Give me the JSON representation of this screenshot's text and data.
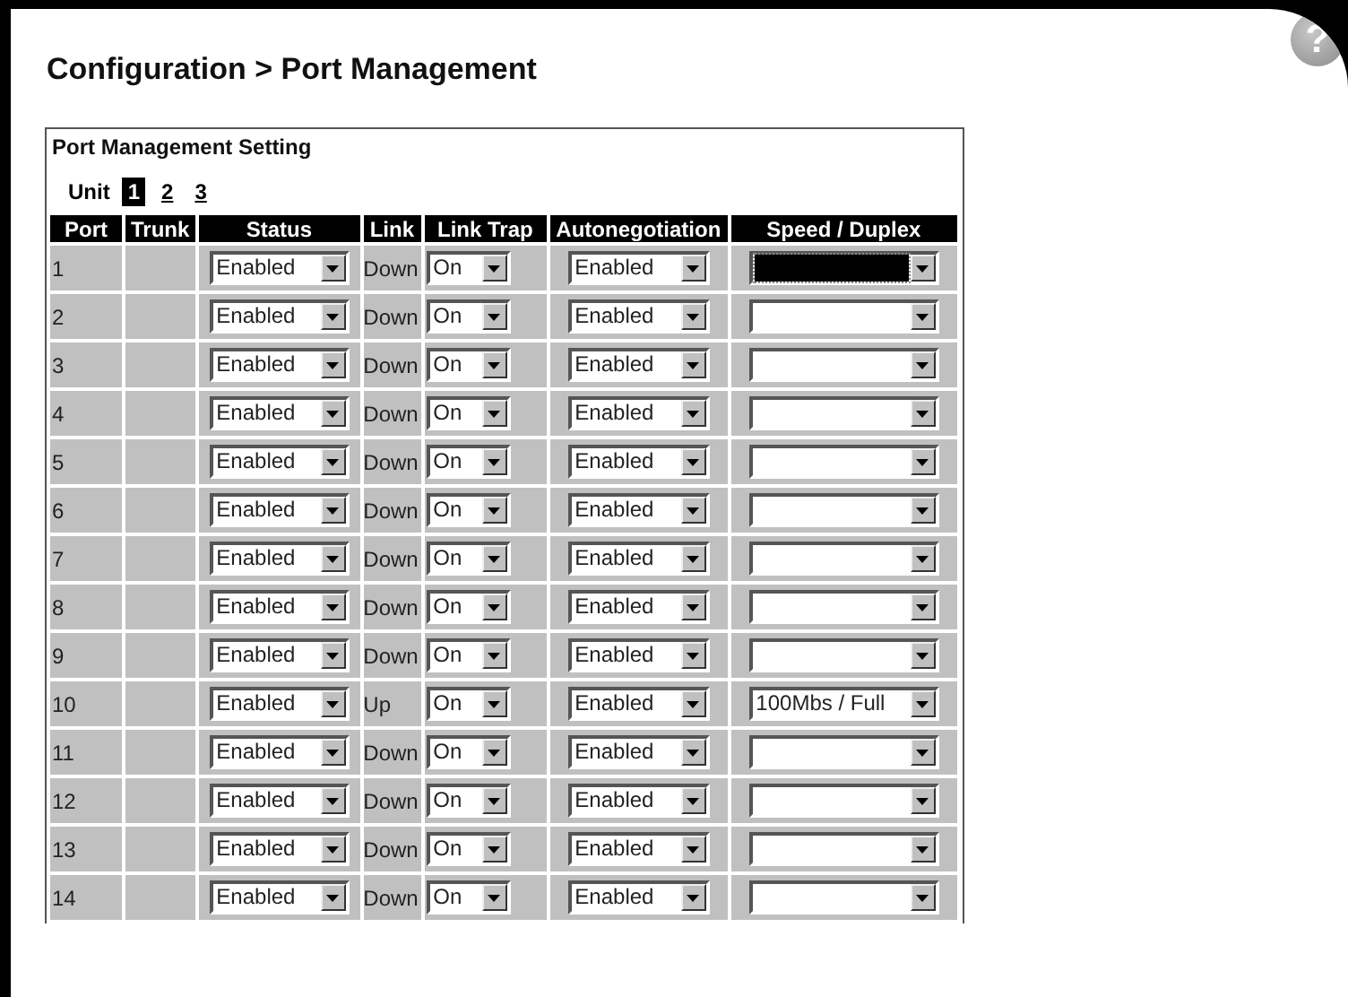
{
  "page_title": "Configuration > Port Management",
  "help": {
    "glyph": "?"
  },
  "section_title": "Port Management Setting",
  "unit_label": "Unit",
  "units": [
    {
      "label": "1",
      "selected": true
    },
    {
      "label": "2",
      "selected": false
    },
    {
      "label": "3",
      "selected": false
    }
  ],
  "columns": [
    "Port",
    "Trunk",
    "Status",
    "Link",
    "Link Trap",
    "Autonegotiation",
    "Speed / Duplex"
  ],
  "rows": [
    {
      "port": "1",
      "status": "Enabled",
      "link": "Down",
      "link_trap": "On",
      "autonegotiation": "Enabled",
      "speed_duplex": "",
      "focused": true
    },
    {
      "port": "2",
      "status": "Enabled",
      "link": "Down",
      "link_trap": "On",
      "autonegotiation": "Enabled",
      "speed_duplex": "",
      "focused": false
    },
    {
      "port": "3",
      "status": "Enabled",
      "link": "Down",
      "link_trap": "On",
      "autonegotiation": "Enabled",
      "speed_duplex": "",
      "focused": false
    },
    {
      "port": "4",
      "status": "Enabled",
      "link": "Down",
      "link_trap": "On",
      "autonegotiation": "Enabled",
      "speed_duplex": "",
      "focused": false
    },
    {
      "port": "5",
      "status": "Enabled",
      "link": "Down",
      "link_trap": "On",
      "autonegotiation": "Enabled",
      "speed_duplex": "",
      "focused": false
    },
    {
      "port": "6",
      "status": "Enabled",
      "link": "Down",
      "link_trap": "On",
      "autonegotiation": "Enabled",
      "speed_duplex": "",
      "focused": false
    },
    {
      "port": "7",
      "status": "Enabled",
      "link": "Down",
      "link_trap": "On",
      "autonegotiation": "Enabled",
      "speed_duplex": "",
      "focused": false
    },
    {
      "port": "8",
      "status": "Enabled",
      "link": "Down",
      "link_trap": "On",
      "autonegotiation": "Enabled",
      "speed_duplex": "",
      "focused": false
    },
    {
      "port": "9",
      "status": "Enabled",
      "link": "Down",
      "link_trap": "On",
      "autonegotiation": "Enabled",
      "speed_duplex": "",
      "focused": false
    },
    {
      "port": "10",
      "status": "Enabled",
      "link": "Up",
      "link_trap": "On",
      "autonegotiation": "Enabled",
      "speed_duplex": "100Mbs / Full",
      "focused": false
    },
    {
      "port": "11",
      "status": "Enabled",
      "link": "Down",
      "link_trap": "On",
      "autonegotiation": "Enabled",
      "speed_duplex": "",
      "focused": false
    },
    {
      "port": "12",
      "status": "Enabled",
      "link": "Down",
      "link_trap": "On",
      "autonegotiation": "Enabled",
      "speed_duplex": "",
      "focused": false
    },
    {
      "port": "13",
      "status": "Enabled",
      "link": "Down",
      "link_trap": "On",
      "autonegotiation": "Enabled",
      "speed_duplex": "",
      "focused": false
    },
    {
      "port": "14",
      "status": "Enabled",
      "link": "Down",
      "link_trap": "On",
      "autonegotiation": "Enabled",
      "speed_duplex": "",
      "focused": false
    }
  ]
}
